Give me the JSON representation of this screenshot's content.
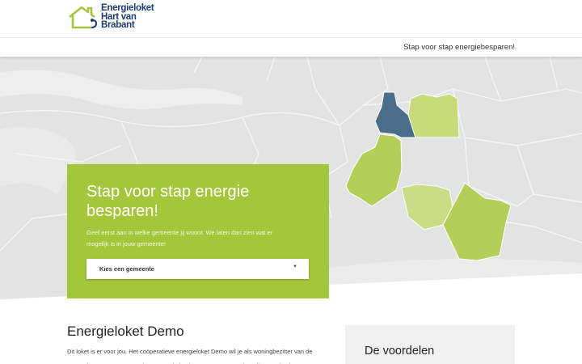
{
  "logo": {
    "line1": "Energieloket",
    "line2": "Hart van",
    "line3": "Brabant",
    "icon": "house-plug-icon"
  },
  "nav": {
    "link": "Stap voor stap energiebesparen!"
  },
  "hero": {
    "title": "Stap voor stap energie besparen!",
    "text": "Geef eerst aan in welke gemeente jij woont. We laten dan zien wat er mogelijk is in jouw gemeente!",
    "select": {
      "value": "Kies een gemeente",
      "caret": "▼"
    }
  },
  "content": {
    "title": "Energieloket Demo",
    "text": "Dit loket is er voor jou. Het coöperatieve energieloket Demo wil je als woningbezitter van de aangesloten gemeenten ondersteunen in het besparen van energie. Wij geven je niet"
  },
  "sidebar": {
    "title": "De voordelen"
  },
  "colors": {
    "accent_green": "#a4c63b",
    "brand_blue": "#1d3c6e",
    "selected_region": "#4a6e8a",
    "region_light": "#c7db7a",
    "region_mid": "#b3cf5a"
  }
}
